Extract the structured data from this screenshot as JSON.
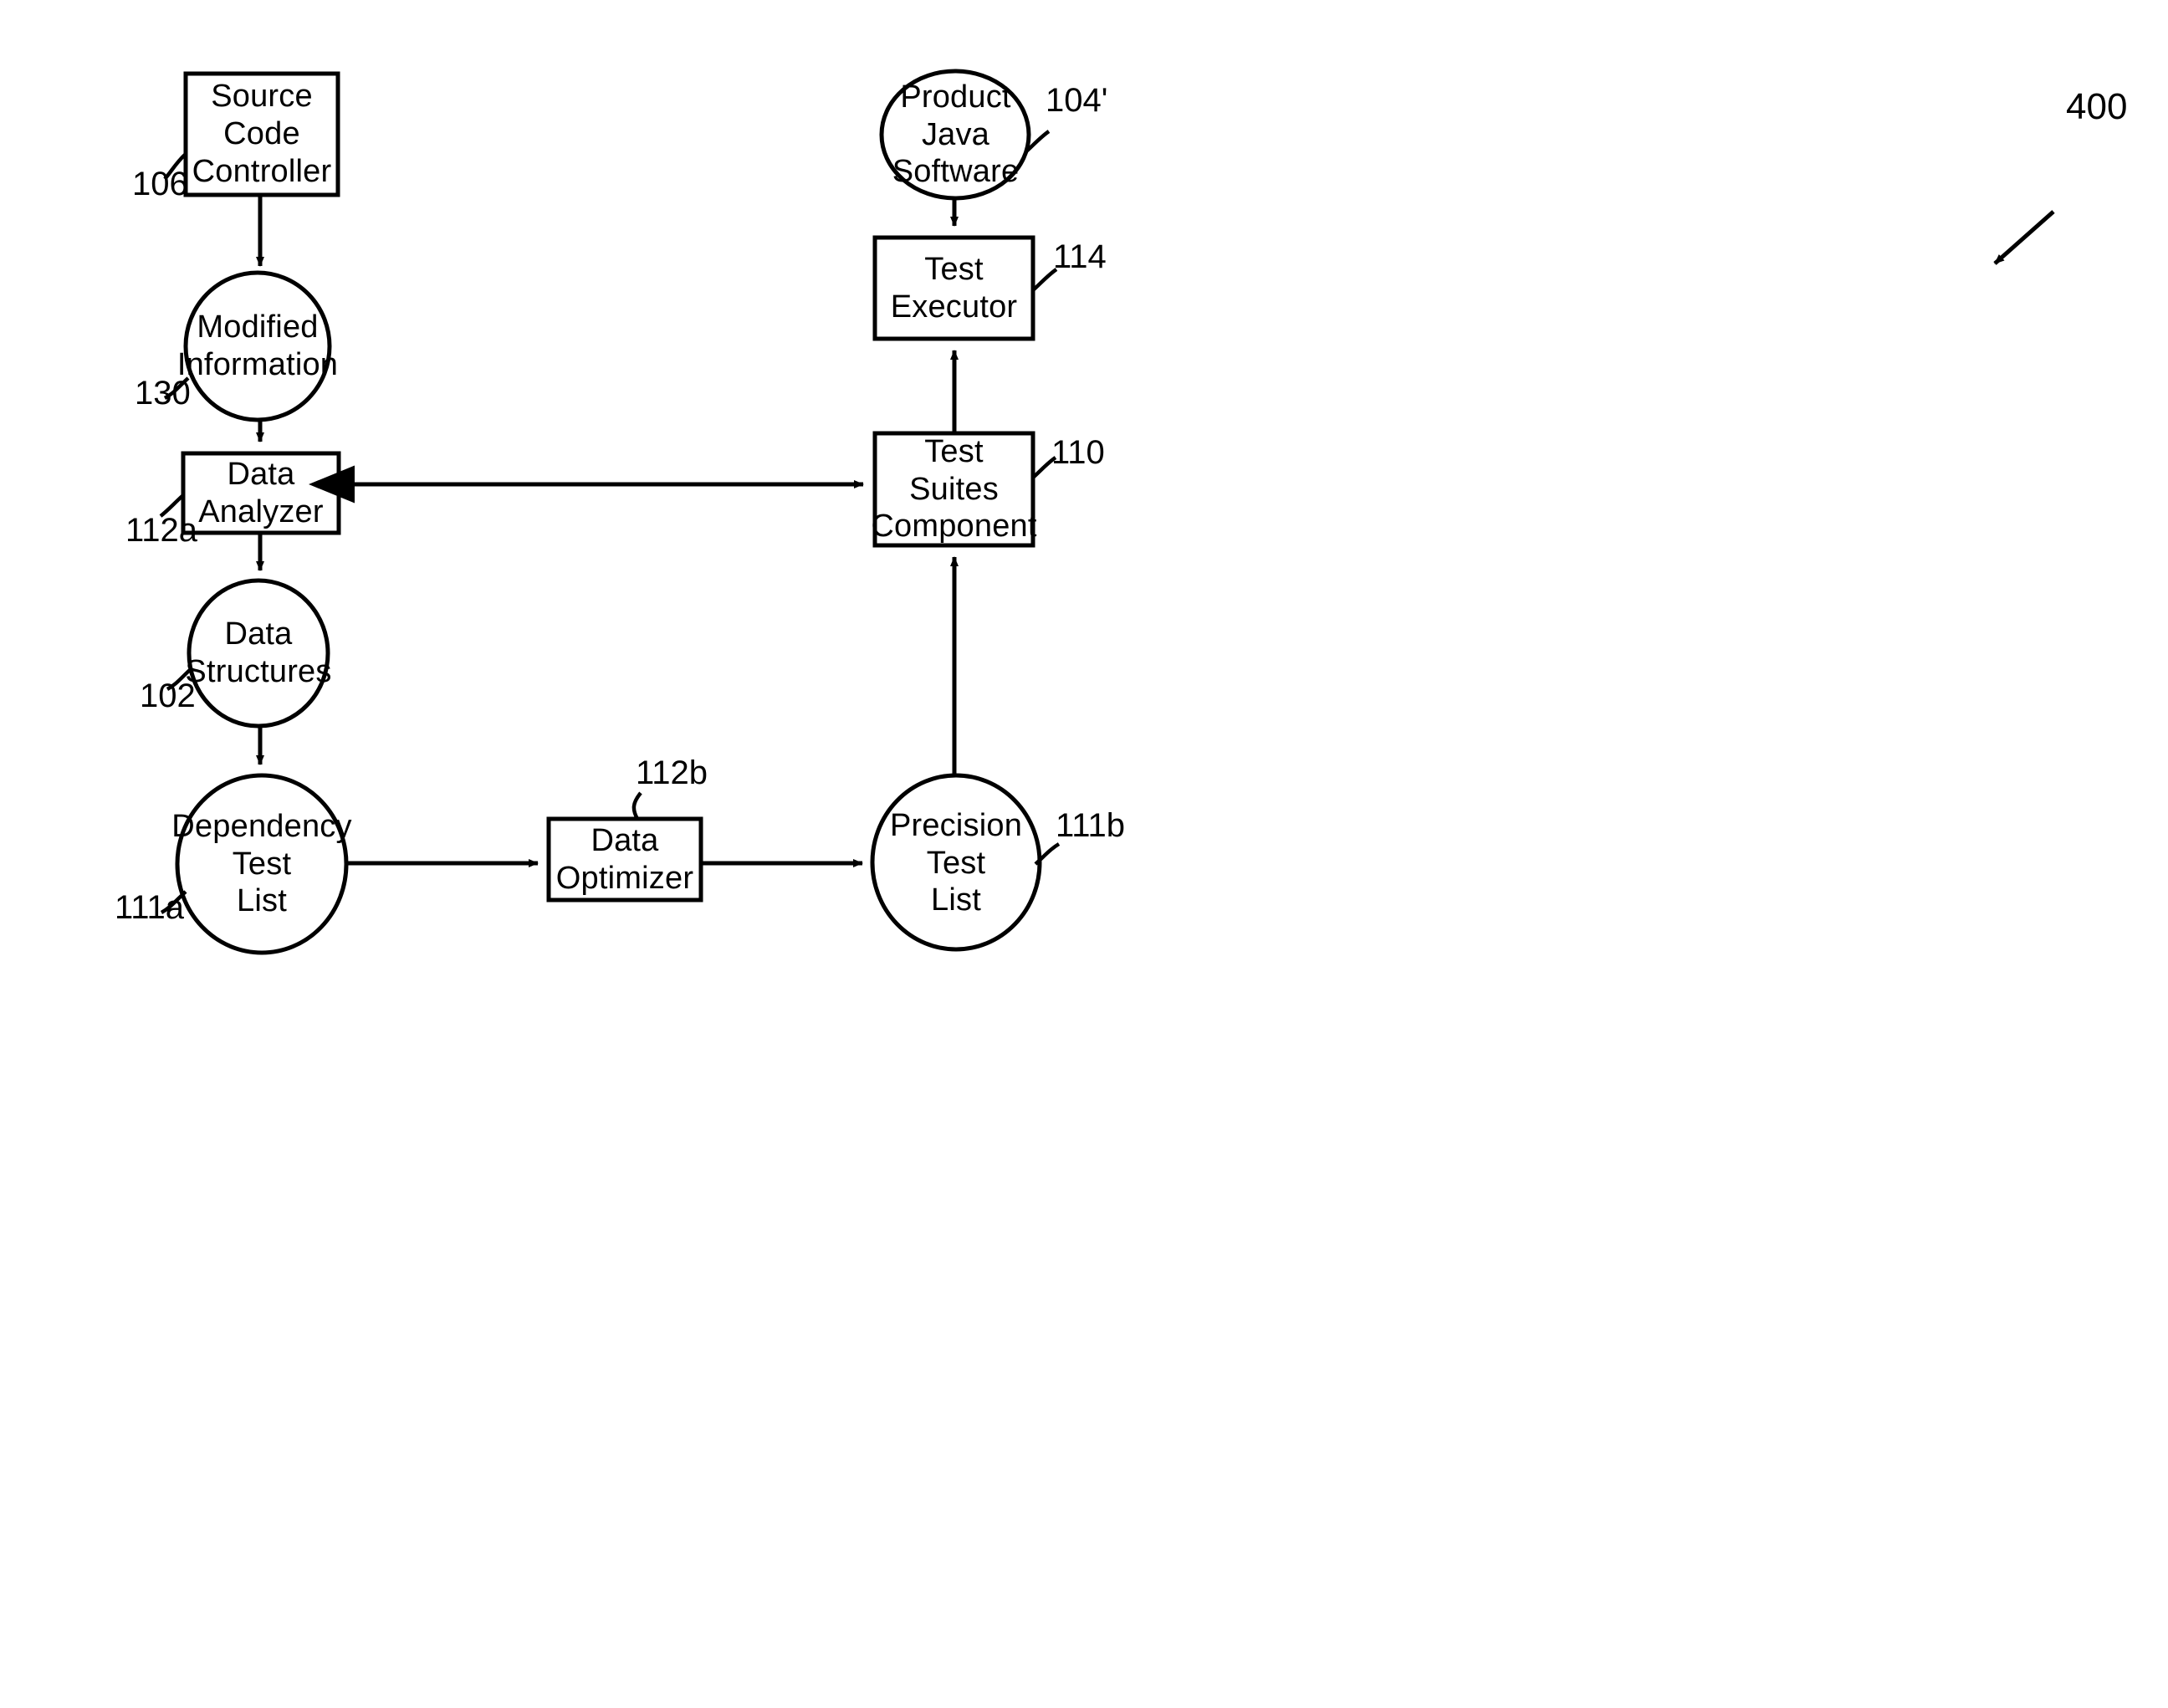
{
  "figure": {
    "number": "400",
    "title_note": "Patent flow diagram"
  },
  "nodes": {
    "source_code_controller": {
      "label": "Source\nCode\nController",
      "ref": "106",
      "shape": "rectangle"
    },
    "modified_information": {
      "label": "Modified\nInformation",
      "ref": "130",
      "shape": "ellipse"
    },
    "data_analyzer": {
      "label": "Data\nAnalyzer",
      "ref": "112a",
      "shape": "rectangle"
    },
    "data_structures": {
      "label": "Data\nStructures",
      "ref": "102",
      "shape": "ellipse"
    },
    "dependency_test_list": {
      "label": "Dependency\nTest\nList",
      "ref": "111a",
      "shape": "ellipse"
    },
    "data_optimizer": {
      "label": "Data\nOptimizer",
      "ref": "112b",
      "shape": "rectangle"
    },
    "precision_test_list": {
      "label": "Precision\nTest\nList",
      "ref": "111b",
      "shape": "ellipse"
    },
    "test_suites_component": {
      "label": "Test\nSuites\nComponent",
      "ref": "110",
      "shape": "rectangle"
    },
    "test_executor": {
      "label": "Test\nExecutor",
      "ref": "114",
      "shape": "rectangle"
    },
    "product_java_software": {
      "label": "Product\nJava\nSoftware",
      "ref": "104'",
      "shape": "ellipse"
    }
  },
  "edges": [
    {
      "from": "source_code_controller",
      "to": "modified_information",
      "direction": "down"
    },
    {
      "from": "modified_information",
      "to": "data_analyzer",
      "direction": "down"
    },
    {
      "from": "data_analyzer",
      "to": "data_structures",
      "direction": "down"
    },
    {
      "from": "data_structures",
      "to": "dependency_test_list",
      "direction": "down"
    },
    {
      "from": "dependency_test_list",
      "to": "data_optimizer",
      "direction": "right"
    },
    {
      "from": "data_optimizer",
      "to": "precision_test_list",
      "direction": "right"
    },
    {
      "from": "precision_test_list",
      "to": "test_suites_component",
      "direction": "up"
    },
    {
      "from": "test_suites_component",
      "to": "test_executor",
      "direction": "up"
    },
    {
      "from": "product_java_software",
      "to": "test_executor",
      "direction": "down"
    },
    {
      "from": "test_suites_component",
      "to": "data_analyzer",
      "direction": "bidirectional"
    }
  ],
  "colors": {
    "stroke": "#000000",
    "background": "#ffffff",
    "text": "#000000"
  }
}
